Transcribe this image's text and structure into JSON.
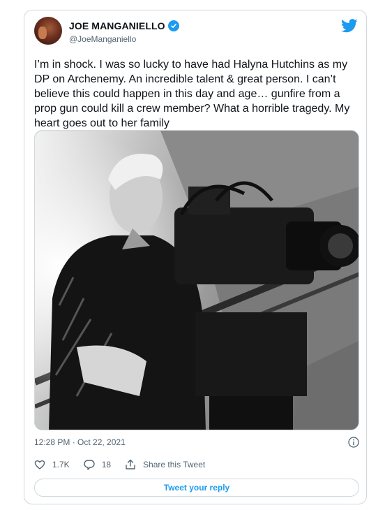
{
  "tweet": {
    "display_name": "JOE MANGANIELLO",
    "handle": "@JoeManganiello",
    "verified": true,
    "text": "I’m in shock. I was so lucky to have had Halyna Hutchins as my DP on Archenemy. An incredible talent & great person. I can’t believe this could happen in this day and age… gunfire from a prop gun could kill a crew member? What a horrible tragedy. My heart goes out to her family",
    "timestamp": "12:28 PM · Oct 22, 2021",
    "likes": "1.7K",
    "replies": "18",
    "share_label": "Share this Tweet",
    "reply_button_label": "Tweet your reply"
  },
  "colors": {
    "accent": "#1d9bf0",
    "secondary_text": "#536471",
    "border": "#cfd9de"
  },
  "icons": [
    "verified-badge-icon",
    "twitter-bird-icon",
    "info-icon",
    "heart-icon",
    "reply-bubble-icon",
    "share-icon"
  ]
}
